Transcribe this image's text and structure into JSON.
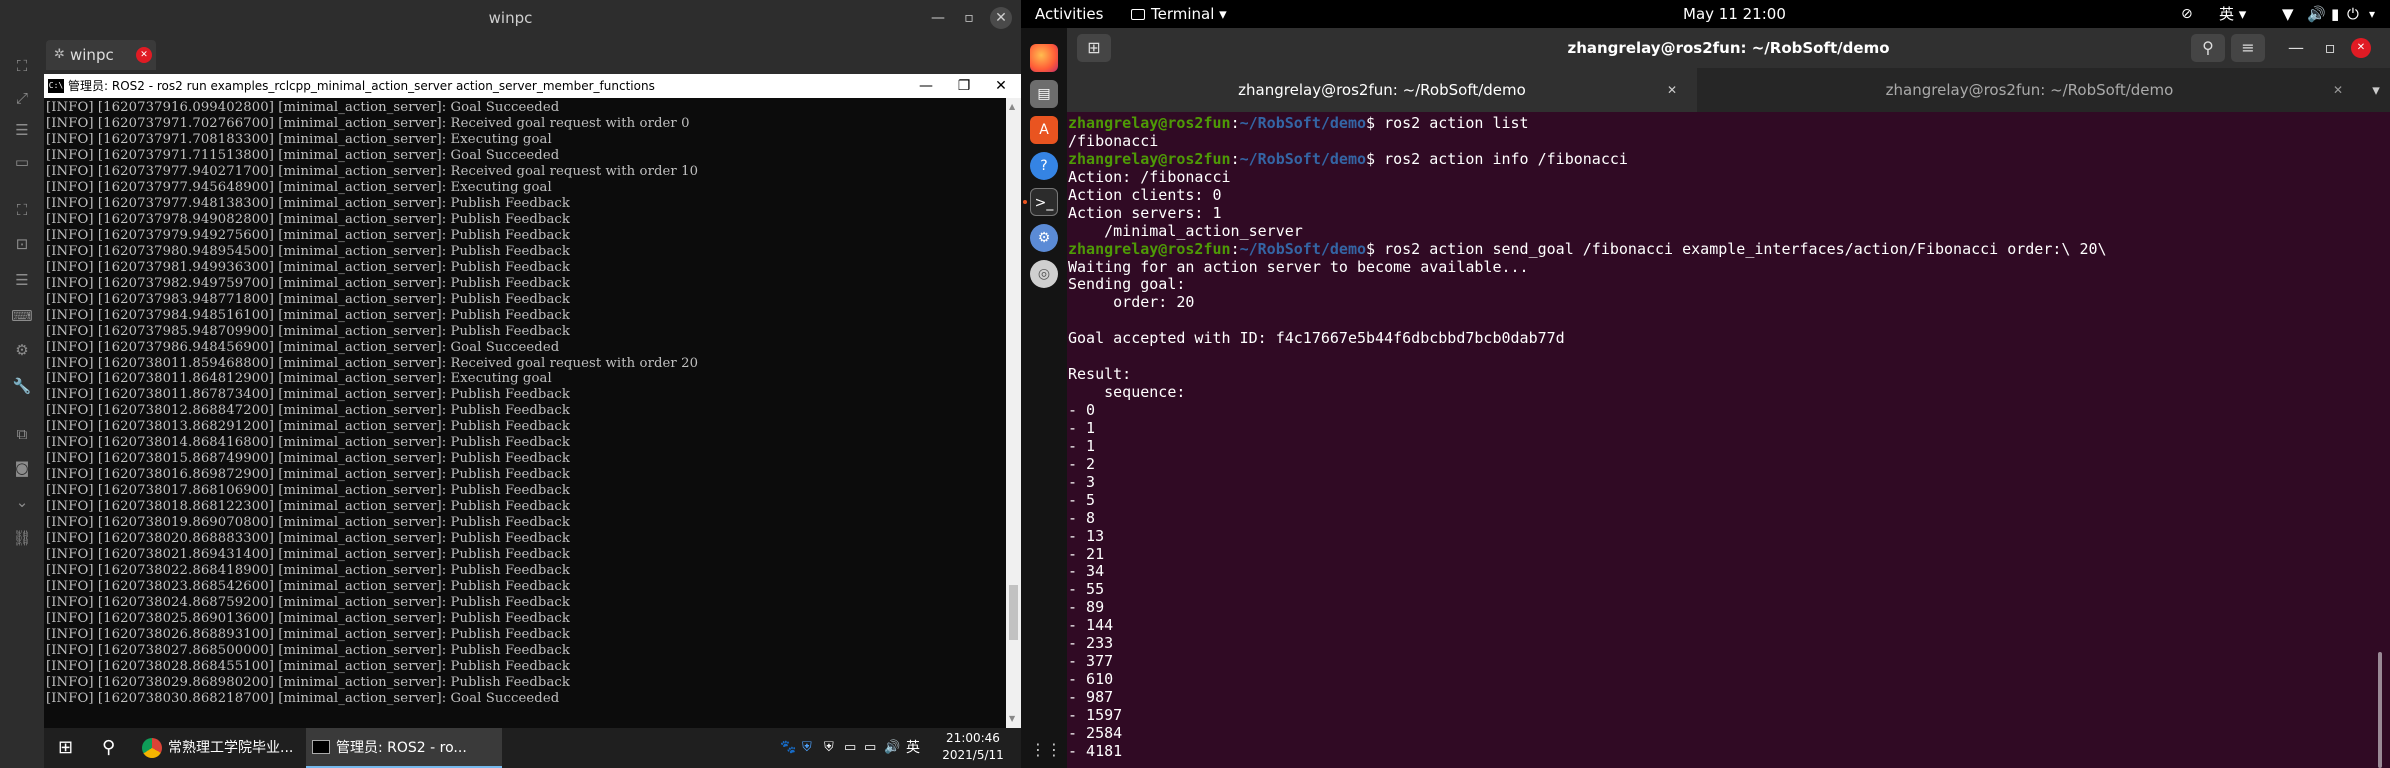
{
  "remote_window": {
    "title": "winpc",
    "controls": {
      "minimize": "—",
      "maximize": "▫",
      "close": "✕"
    },
    "tab": {
      "label": "winpc",
      "close": "✕"
    },
    "sidebar_icons": [
      "fullscreen-icon",
      "resize-icon",
      "list-icon",
      "window-icon",
      "screen-icon",
      "monitor-icon",
      "menu-icon",
      "keyboard-icon",
      "settings-icon",
      "wrench-icon",
      "copy-icon",
      "camera-icon",
      "chevron-down-icon",
      "link-icon"
    ]
  },
  "cmd_window": {
    "title": "管理员: ROS2 - ros2  run examples_rclcpp_minimal_action_server action_server_member_functions",
    "icon_label": "C:\\",
    "controls": {
      "minimize": "—",
      "maximize": "❐",
      "close": "✕"
    },
    "lines": [
      "[INFO] [1620737916.099402800] [minimal_action_server]: Goal Succeeded",
      "[INFO] [1620737971.702766700] [minimal_action_server]: Received goal request with order 0",
      "[INFO] [1620737971.708183300] [minimal_action_server]: Executing goal",
      "[INFO] [1620737971.711513800] [minimal_action_server]: Goal Succeeded",
      "[INFO] [1620737977.940271700] [minimal_action_server]: Received goal request with order 10",
      "[INFO] [1620737977.945648900] [minimal_action_server]: Executing goal",
      "[INFO] [1620737977.948138300] [minimal_action_server]: Publish Feedback",
      "[INFO] [1620737978.949082800] [minimal_action_server]: Publish Feedback",
      "[INFO] [1620737979.949275600] [minimal_action_server]: Publish Feedback",
      "[INFO] [1620737980.948954500] [minimal_action_server]: Publish Feedback",
      "[INFO] [1620737981.949936300] [minimal_action_server]: Publish Feedback",
      "[INFO] [1620737982.949759700] [minimal_action_server]: Publish Feedback",
      "[INFO] [1620737983.948771800] [minimal_action_server]: Publish Feedback",
      "[INFO] [1620737984.948516100] [minimal_action_server]: Publish Feedback",
      "[INFO] [1620737985.948709900] [minimal_action_server]: Publish Feedback",
      "[INFO] [1620737986.948456900] [minimal_action_server]: Goal Succeeded",
      "[INFO] [1620738011.859468800] [minimal_action_server]: Received goal request with order 20",
      "[INFO] [1620738011.864812900] [minimal_action_server]: Executing goal",
      "[INFO] [1620738011.867873400] [minimal_action_server]: Publish Feedback",
      "[INFO] [1620738012.868847200] [minimal_action_server]: Publish Feedback",
      "[INFO] [1620738013.868291200] [minimal_action_server]: Publish Feedback",
      "[INFO] [1620738014.868416800] [minimal_action_server]: Publish Feedback",
      "[INFO] [1620738015.868749900] [minimal_action_server]: Publish Feedback",
      "[INFO] [1620738016.869872900] [minimal_action_server]: Publish Feedback",
      "[INFO] [1620738017.868106900] [minimal_action_server]: Publish Feedback",
      "[INFO] [1620738018.868122300] [minimal_action_server]: Publish Feedback",
      "[INFO] [1620738019.869070800] [minimal_action_server]: Publish Feedback",
      "[INFO] [1620738020.868883300] [minimal_action_server]: Publish Feedback",
      "[INFO] [1620738021.869431400] [minimal_action_server]: Publish Feedback",
      "[INFO] [1620738022.868418900] [minimal_action_server]: Publish Feedback",
      "[INFO] [1620738023.868542600] [minimal_action_server]: Publish Feedback",
      "[INFO] [1620738024.868759200] [minimal_action_server]: Publish Feedback",
      "[INFO] [1620738025.869013600] [minimal_action_server]: Publish Feedback",
      "[INFO] [1620738026.868893100] [minimal_action_server]: Publish Feedback",
      "[INFO] [1620738027.868500000] [minimal_action_server]: Publish Feedback",
      "[INFO] [1620738028.868455100] [minimal_action_server]: Publish Feedback",
      "[INFO] [1620738029.868980200] [minimal_action_server]: Publish Feedback",
      "[INFO] [1620738030.868218700] [minimal_action_server]: Goal Succeeded",
      "_"
    ]
  },
  "windows_taskbar": {
    "start_icon": "windows-start-icon",
    "search_icon": "⚲",
    "chrome_label": "常熟理工学院毕业...",
    "cmd_label": "管理员: ROS2 - ro...",
    "tray_icons": [
      "🐾",
      "⛨",
      "⛨",
      "▭",
      "▭",
      "🔊"
    ],
    "ime": "英",
    "time": "21:00:46",
    "date": "2021/5/11"
  },
  "ubuntu_topbar": {
    "activities": "Activities",
    "app_menu": "Terminal ▾",
    "clock": "May 11  21:00",
    "input_method": "英 ▾",
    "tray_icons": [
      "network-icon",
      "volume-icon",
      "battery-icon",
      "power-icon"
    ],
    "menu_arrow": "▾"
  },
  "dock": {
    "icons": [
      "firefox-icon",
      "files-icon",
      "software-icon",
      "help-icon",
      "terminal-icon",
      "settings-icon",
      "disc-icon",
      "apps-grid-icon"
    ]
  },
  "terminal": {
    "title": "zhangrelay@ros2fun: ~/RobSoft/demo",
    "new_tab_icon": "⊞",
    "search_icon": "⚲",
    "menu_icon": "≡",
    "minimize": "—",
    "maximize": "▫",
    "close": "✕",
    "tabs": [
      {
        "label": "zhangrelay@ros2fun: ~/RobSoft/demo",
        "close": "✕",
        "active": true
      },
      {
        "label": "zhangrelay@ros2fun: ~/RobSoft/demo",
        "close": "✕",
        "active": false
      }
    ],
    "tabs_menu": "▾",
    "prompt_user": "zhangrelay@ros2fun",
    "prompt_sep": ":",
    "prompt_path": "~/RobSoft/demo",
    "prompt_dollar": "$ ",
    "lines": [
      {
        "type": "cmd",
        "text": "ros2 action list"
      },
      {
        "type": "out",
        "text": "/fibonacci"
      },
      {
        "type": "cmd",
        "text": "ros2 action info /fibonacci"
      },
      {
        "type": "out",
        "text": "Action: /fibonacci"
      },
      {
        "type": "out",
        "text": "Action clients: 0"
      },
      {
        "type": "out",
        "text": "Action servers: 1"
      },
      {
        "type": "out",
        "text": "    /minimal_action_server"
      },
      {
        "type": "cmd",
        "text": "ros2 action send_goal /fibonacci example_interfaces/action/Fibonacci order:\\ 20\\"
      },
      {
        "type": "out",
        "text": "Waiting for an action server to become available..."
      },
      {
        "type": "out",
        "text": "Sending goal:"
      },
      {
        "type": "out",
        "text": "     order: 20"
      },
      {
        "type": "out",
        "text": ""
      },
      {
        "type": "out",
        "text": "Goal accepted with ID: f4c17667e5b44f6dbcbbd7bcb0dab77d"
      },
      {
        "type": "out",
        "text": ""
      },
      {
        "type": "out",
        "text": "Result:"
      },
      {
        "type": "out",
        "text": "    sequence:"
      },
      {
        "type": "out",
        "text": "- 0"
      },
      {
        "type": "out",
        "text": "- 1"
      },
      {
        "type": "out",
        "text": "- 1"
      },
      {
        "type": "out",
        "text": "- 2"
      },
      {
        "type": "out",
        "text": "- 3"
      },
      {
        "type": "out",
        "text": "- 5"
      },
      {
        "type": "out",
        "text": "- 8"
      },
      {
        "type": "out",
        "text": "- 13"
      },
      {
        "type": "out",
        "text": "- 21"
      },
      {
        "type": "out",
        "text": "- 34"
      },
      {
        "type": "out",
        "text": "- 55"
      },
      {
        "type": "out",
        "text": "- 89"
      },
      {
        "type": "out",
        "text": "- 144"
      },
      {
        "type": "out",
        "text": "- 233"
      },
      {
        "type": "out",
        "text": "- 377"
      },
      {
        "type": "out",
        "text": "- 610"
      },
      {
        "type": "out",
        "text": "- 987"
      },
      {
        "type": "out",
        "text": "- 1597"
      },
      {
        "type": "out",
        "text": "- 2584"
      },
      {
        "type": "out",
        "text": "- 4181"
      }
    ]
  },
  "colors": {
    "terminal_bg": "#300a24",
    "prompt_user": "#4e9a06",
    "prompt_path": "#3465a4",
    "cmd_bg": "#0c0c0c",
    "cmd_text": "#c0c0c0",
    "tab_close_red": "#e01b24"
  }
}
